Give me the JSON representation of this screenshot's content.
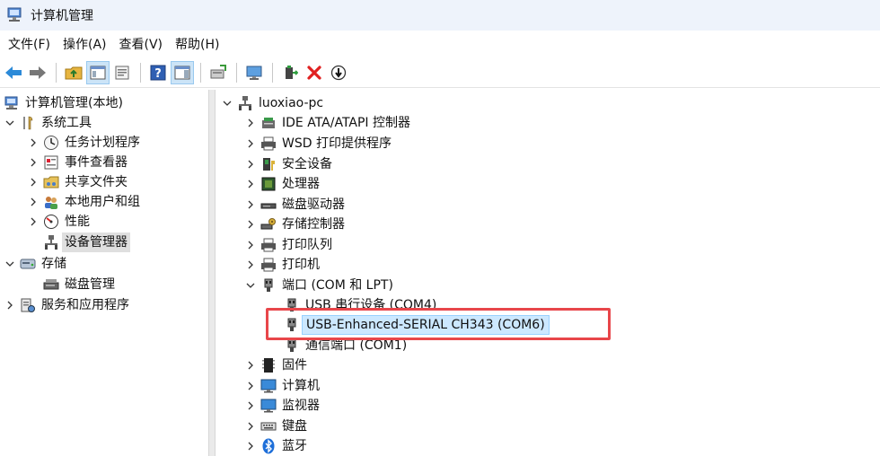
{
  "window": {
    "title": "计算机管理"
  },
  "menu": [
    "文件(F)",
    "操作(A)",
    "查看(V)",
    "帮助(H)"
  ],
  "toolbar": [
    "back-arrow-icon",
    "forward-arrow-icon",
    "up-folder-icon",
    "show-tree-icon",
    "properties-icon",
    "help-icon",
    "action-pane-icon",
    "update-driver-icon",
    "scan-hardware-icon",
    "enable-device-icon",
    "uninstall-icon",
    "disable-device-icon"
  ],
  "left_tree": {
    "root": "计算机管理(本地)",
    "system_tools": "系统工具",
    "task_scheduler": "任务计划程序",
    "event_viewer": "事件查看器",
    "shared_folders": "共享文件夹",
    "local_users": "本地用户和组",
    "performance": "性能",
    "device_manager": "设备管理器",
    "storage": "存储",
    "disk_management": "磁盘管理",
    "services_apps": "服务和应用程序"
  },
  "device_tree": {
    "computer_name": "luoxiao-pc",
    "ide": "IDE ATA/ATAPI 控制器",
    "wsd": "WSD 打印提供程序",
    "security": "安全设备",
    "processors": "处理器",
    "disk_drives": "磁盘驱动器",
    "storage_controllers": "存储控制器",
    "print_queues": "打印队列",
    "printers": "打印机",
    "ports": "端口 (COM 和 LPT)",
    "port_com4": "USB 串行设备 (COM4)",
    "port_com6": "USB-Enhanced-SERIAL CH343 (COM6)",
    "port_com1": "通信端口 (COM1)",
    "firmware": "固件",
    "computer": "计算机",
    "monitors": "监视器",
    "keyboards": "键盘",
    "bluetooth": "蓝牙"
  },
  "colors": {
    "selection": "#cce8ff",
    "annotation": "#e8464a",
    "titlebar": "#eef3fb"
  }
}
